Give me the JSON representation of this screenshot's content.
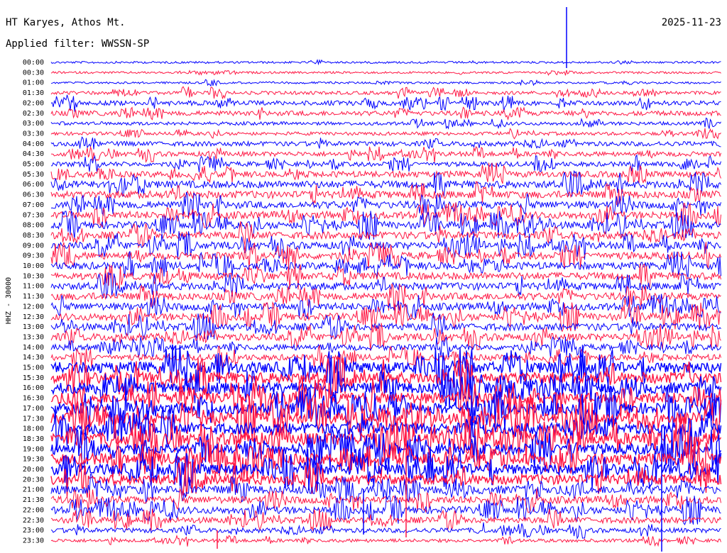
{
  "header": {
    "station": "HT Karyes, Athos Mt.",
    "filter": "Applied filter: WWSSN-SP",
    "date": "2025-11-23"
  },
  "chart_data": {
    "type": "line",
    "title": "HT Karyes, Athos Mt.",
    "subtitle": "Applied filter: WWSSN-SP",
    "date": "2025-11-23",
    "ylabel": "HHZ - 30000",
    "xlabel": "",
    "rows": [
      "00:00",
      "00:30",
      "01:00",
      "01:30",
      "02:00",
      "02:30",
      "03:00",
      "03:30",
      "04:00",
      "04:30",
      "05:00",
      "05:30",
      "06:00",
      "06:30",
      "07:00",
      "07:30",
      "08:00",
      "08:30",
      "09:00",
      "09:30",
      "10:00",
      "10:30",
      "11:00",
      "11:30",
      "12:00",
      "12:30",
      "13:00",
      "13:30",
      "14:00",
      "14:30",
      "15:00",
      "15:30",
      "16:00",
      "16:30",
      "17:00",
      "17:30",
      "18:00",
      "18:30",
      "19:00",
      "19:30",
      "20:00",
      "20:30",
      "21:00",
      "21:30",
      "22:00",
      "22:30",
      "23:00",
      "23:30"
    ],
    "colors": [
      "#0000ff",
      "#ff1744"
    ],
    "noise_level": [
      1,
      1,
      1,
      2,
      3,
      3,
      2,
      2,
      3,
      3,
      3,
      4,
      5,
      5,
      5,
      5,
      5,
      5,
      5,
      5,
      5,
      5,
      5,
      5,
      5,
      5,
      5,
      5,
      4,
      4,
      8,
      8,
      8,
      8,
      8,
      8,
      8,
      9,
      8,
      8,
      8,
      7,
      6,
      5,
      5,
      4,
      3,
      2
    ],
    "grid": false,
    "legend": "none"
  }
}
